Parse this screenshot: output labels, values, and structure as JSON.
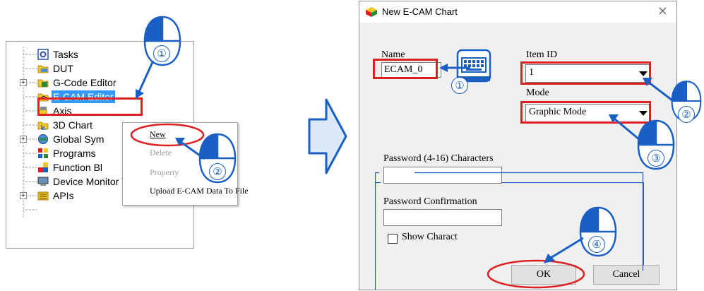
{
  "tree": {
    "items": [
      {
        "label": "Tasks",
        "icon": "tasks-icon"
      },
      {
        "label": "DUT",
        "icon": "folder-icon"
      },
      {
        "label": "G-Code Editor",
        "icon": "folder-icon"
      },
      {
        "label": "E-CAM Editor",
        "icon": "ecam-folder-icon"
      },
      {
        "label": "Axis",
        "icon": "axis-icon"
      },
      {
        "label": "3D Chart",
        "icon": "chart-icon"
      },
      {
        "label": "Global Sym",
        "icon": "globe-icon"
      },
      {
        "label": "Programs",
        "icon": "programs-icon"
      },
      {
        "label": "Function Bl",
        "icon": "function-block-icon"
      },
      {
        "label": "Device Monitor Table",
        "icon": "monitor-icon"
      },
      {
        "label": "APIs",
        "icon": "apis-icon"
      }
    ],
    "expander_symbol": "+"
  },
  "context_menu": {
    "items": [
      {
        "label": "New",
        "enabled": true
      },
      {
        "label": "Delete",
        "enabled": false
      },
      {
        "label": "Property",
        "enabled": false
      },
      {
        "label": "Upload E-CAM Data To File",
        "enabled": true
      }
    ]
  },
  "dialog": {
    "title": "New E-CAM Chart",
    "close_glyph": "×",
    "name_label": "Name",
    "name_value": "ECAM_0",
    "item_id_label": "Item ID",
    "item_id_value": "1",
    "mode_label": "Mode",
    "mode_value": "Graphic Mode",
    "password_group": "Password",
    "password_label": "Password (4-16) Characters",
    "password_value": "",
    "confirm_label": "Password Confirmation",
    "confirm_value": "",
    "show_chars_label": "Show Charact",
    "ok_label": "OK",
    "cancel_label": "Cancel"
  },
  "callouts": [
    "①",
    "②",
    "①",
    "②",
    "③",
    "④"
  ],
  "colors": {
    "highlight_red": "#e02020",
    "callout_blue": "#1a5fc4",
    "selection_blue": "#3399ff",
    "arrow_fill": "#dbe9fb"
  }
}
